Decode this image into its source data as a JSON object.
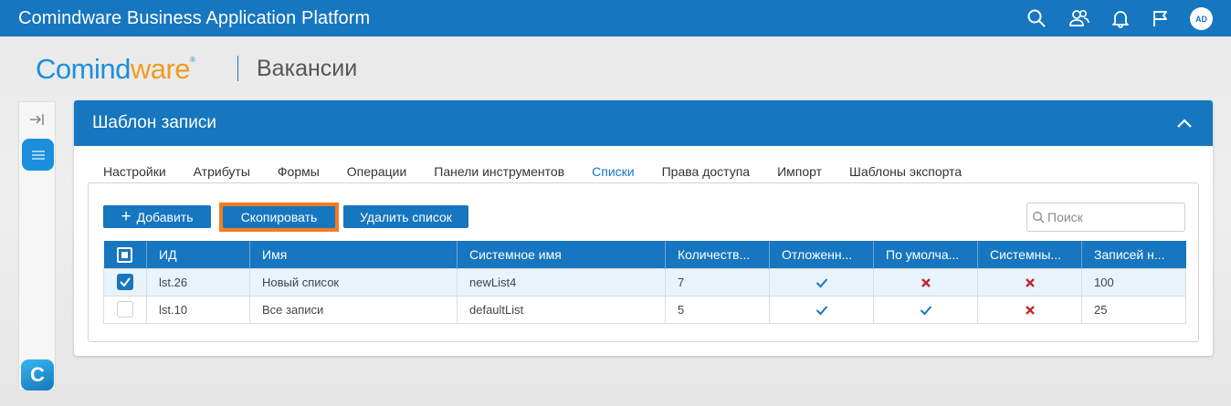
{
  "app": {
    "title": "Comindware Business Application Platform",
    "avatar_initials": "AD"
  },
  "brand": {
    "logo_part1": "Comind",
    "logo_part2": "ware",
    "logo_reg": "®",
    "page_title": "Вакансии"
  },
  "card": {
    "title": "Шаблон записи"
  },
  "tabs": [
    {
      "label": "Настройки"
    },
    {
      "label": "Атрибуты"
    },
    {
      "label": "Формы"
    },
    {
      "label": "Операции"
    },
    {
      "label": "Панели инструментов"
    },
    {
      "label": "Списки",
      "active": true
    },
    {
      "label": "Права доступа"
    },
    {
      "label": "Импорт"
    },
    {
      "label": "Шаблоны экспорта"
    }
  ],
  "toolbar": {
    "add_label": "Добавить",
    "copy_label": "Скопировать",
    "delete_label": "Удалить список",
    "search_placeholder": "Поиск"
  },
  "table": {
    "columns": [
      "ИД",
      "Имя",
      "Системное имя",
      "Количеств...",
      "Отложенн...",
      "По умолча...",
      "Системны...",
      "Записей н..."
    ],
    "rows": [
      {
        "selected": true,
        "id": "lst.26",
        "name": "Новый список",
        "system_name": "newList4",
        "count": "7",
        "deferred": "check",
        "default": "cross",
        "system": "cross",
        "records": "100"
      },
      {
        "selected": false,
        "id": "lst.10",
        "name": "Все записи",
        "system_name": "defaultList",
        "count": "5",
        "deferred": "check",
        "default": "check",
        "system": "cross",
        "records": "25"
      }
    ]
  },
  "colors": {
    "primary": "#1676bf",
    "accent_orange": "#f47c20",
    "check": "#1676bf",
    "cross": "#c0282d"
  }
}
